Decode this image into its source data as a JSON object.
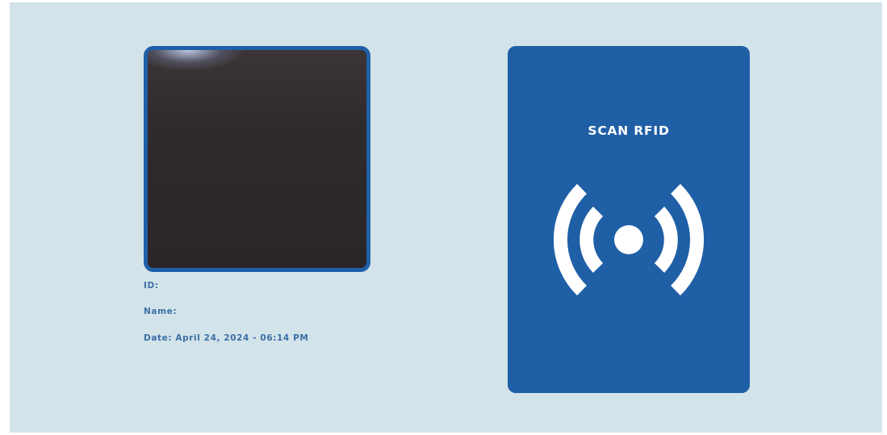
{
  "camera": {
    "label": "camera-preview"
  },
  "info": {
    "id_label": "ID:",
    "name_label": "Name:",
    "date_label": "Date: April 24, 2024 - 06:14 PM"
  },
  "rfid": {
    "title": "SCAN RFID",
    "icon": "rfid-broadcast-icon"
  },
  "colors": {
    "background": "#d2e3ea",
    "primary": "#1f5fa6",
    "frame_accent": "#2ea7c9",
    "label_text": "#3c6fa6"
  }
}
